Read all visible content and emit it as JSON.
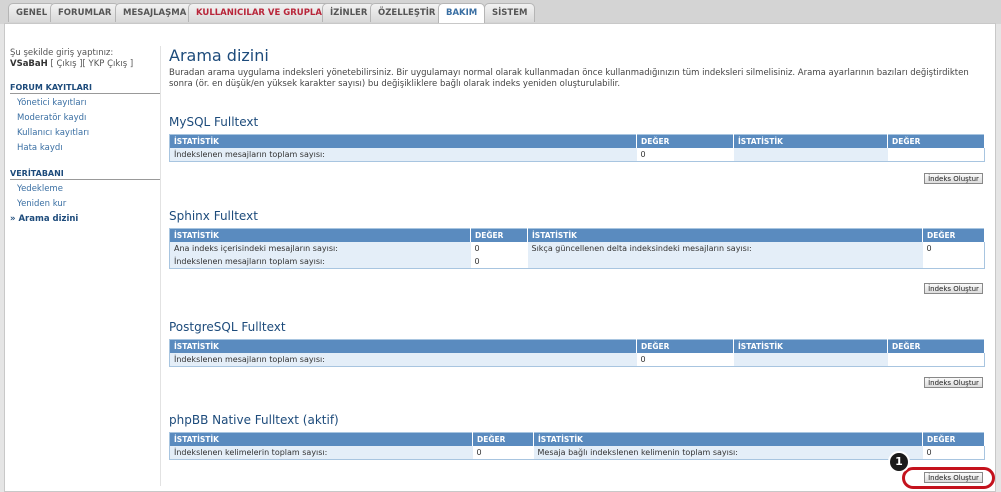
{
  "tabs": [
    "GENEL",
    "FORUMLAR",
    "MESAJLAŞMA",
    "KULLANICILAR VE GRUPLAR",
    "İZİNLER",
    "ÖZELLEŞTİR",
    "BAKIM",
    "SİSTEM"
  ],
  "login": {
    "text": "Şu şekilde giriş yaptınız:",
    "user": "VSaBaH",
    "links": "[ Çıkış ][ YKP Çıkış ]"
  },
  "sidebar": {
    "forum_logs_title": "FORUM KAYITLARI",
    "forum_logs": [
      "Yönetici kayıtları",
      "Moderatör kaydı",
      "Kullanıcı kayıtları",
      "Hata kaydı"
    ],
    "db_title": "VERİTABANI",
    "db_items": [
      "Yedekleme",
      "Yeniden kur",
      "Arama dizini"
    ]
  },
  "page": {
    "title": "Arama dizini",
    "description": "Buradan arama uygulama indeksleri yönetebilirsiniz. Bir uygulamayı normal olarak kullanmadan önce kullanmadığınızın tüm indeksleri silmelisiniz. Arama ayarlarının bazıları değiştirdikten sonra (ör. en düşük/en yüksek karakter sayısı) bu değişikliklere bağlı olarak indeks yeniden oluşturulabilir."
  },
  "headers": {
    "stat": "İSTATİSTİK",
    "value": "DEĞER"
  },
  "button_label": "İndeks Oluştur",
  "sections": {
    "mysql": {
      "title": "MySQL Fulltext",
      "row1_label": "İndekslenen mesajların toplam sayısı:",
      "row1_value": "0"
    },
    "sphinx": {
      "title": "Sphinx Fulltext",
      "row1_label": "Ana indeks içerisindeki mesajların sayısı:",
      "row1_value": "0",
      "row1_label2": "Sıkça güncellenen delta indeksindeki mesajların sayısı:",
      "row1_value2": "0",
      "row2_label": "İndekslenen mesajların toplam sayısı:",
      "row2_value": "0"
    },
    "postgres": {
      "title": "PostgreSQL Fulltext",
      "row1_label": "İndekslenen mesajların toplam sayısı:",
      "row1_value": "0"
    },
    "native": {
      "title": "phpBB Native Fulltext (aktif)",
      "row1_label": "İndekslenen kelimelerin toplam sayısı:",
      "row1_value": "0",
      "row1_label2": "Mesaja bağlı indekslenen kelimenin toplam sayısı:",
      "row1_value2": "0"
    }
  },
  "callout": {
    "number": "1",
    "color": "#c4121d"
  }
}
